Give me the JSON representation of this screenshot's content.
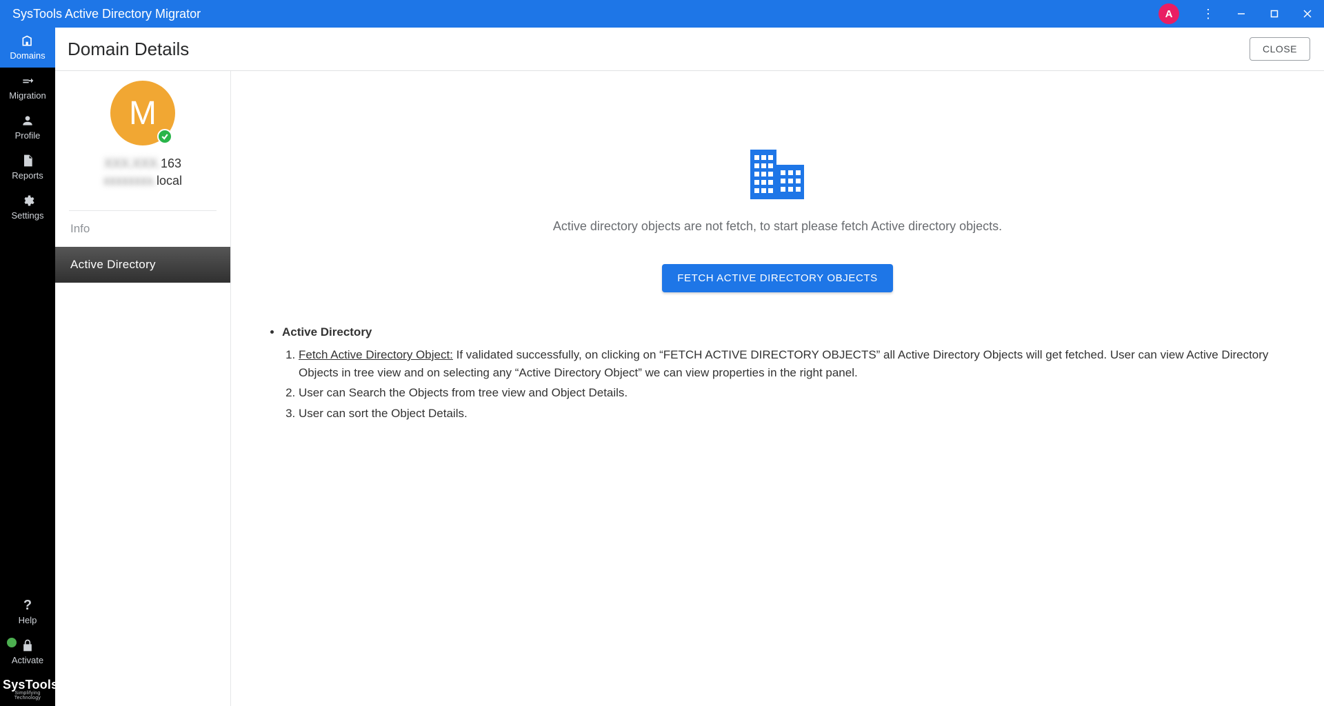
{
  "titlebar": {
    "title": "SysTools Active Directory Migrator",
    "avatar_letter": "A"
  },
  "leftnav": {
    "items": [
      {
        "label": "Domains",
        "active": true
      },
      {
        "label": "Migration",
        "active": false
      },
      {
        "label": "Profile",
        "active": false
      },
      {
        "label": "Reports",
        "active": false
      },
      {
        "label": "Settings",
        "active": false
      }
    ],
    "bottom_items": [
      {
        "label": "Help"
      },
      {
        "label": "Activate"
      }
    ],
    "brand": "SysTools",
    "brand_tagline": "Simplifying Technology"
  },
  "page_header": {
    "title": "Domain Details",
    "close_label": "CLOSE"
  },
  "subpanel": {
    "avatar_letter": "M",
    "ip_visible_suffix": "163",
    "domain_visible_suffix": "local",
    "nav": [
      {
        "label": "Info",
        "active": false
      },
      {
        "label": "Active Directory",
        "active": true
      }
    ]
  },
  "mainpane": {
    "empty_text": "Active directory objects are not fetch, to start please fetch Active directory objects.",
    "fetch_button_label": "FETCH ACTIVE DIRECTORY OBJECTS",
    "help_heading": "Active Directory",
    "help_items": [
      {
        "lead": "Fetch Active Directory Object:",
        "rest": " If validated successfully, on clicking on “FETCH ACTIVE DIRECTORY OBJECTS” all Active Directory Objects will get fetched. User can view Active Directory Objects in tree view and on selecting any “Active Directory Object” we can view properties in the right panel."
      },
      {
        "rest": "User can Search the Objects from tree view and Object Details."
      },
      {
        "rest": "User can sort the Object Details."
      }
    ]
  }
}
